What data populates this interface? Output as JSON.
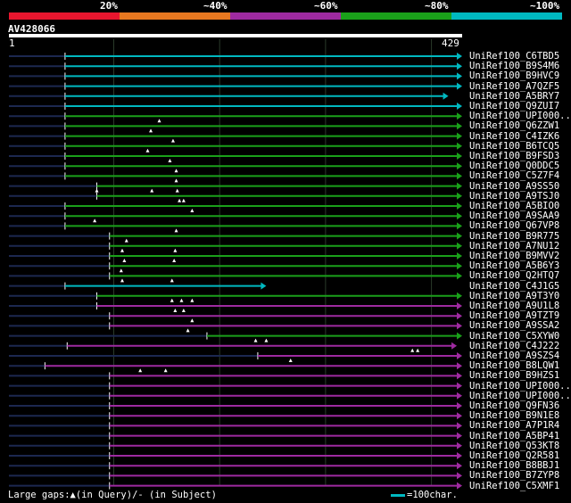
{
  "legend": {
    "labels": [
      "20%",
      "~40%",
      "~60%",
      "~80%",
      "~100%"
    ],
    "colors": [
      "#e8162e",
      "#e87820",
      "#9e2aa0",
      "#1aa01a",
      "#00b8c0"
    ]
  },
  "query": {
    "title": "AV428066",
    "start": "1",
    "end": "429",
    "length": 429
  },
  "footer": {
    "gaps": "Large gaps:▲(in Query)/- (in Subject)",
    "key": "=100char."
  },
  "hits": [
    {
      "name": "UniRef100_C6TBD5",
      "color": "cyan",
      "start": 54,
      "end": 429,
      "arrow": true,
      "ticks": []
    },
    {
      "name": "UniRef100_B9S4M6",
      "color": "cyan",
      "start": 54,
      "end": 429,
      "arrow": true,
      "ticks": []
    },
    {
      "name": "UniRef100_B9HVC9",
      "color": "cyan",
      "start": 54,
      "end": 429,
      "arrow": true,
      "ticks": []
    },
    {
      "name": "UniRef100_A7QZF5",
      "color": "cyan",
      "start": 54,
      "end": 429,
      "arrow": true,
      "ticks": []
    },
    {
      "name": "UniRef100_A5BRY7",
      "color": "cyan",
      "start": 54,
      "end": 416,
      "arrow": true,
      "ticks": []
    },
    {
      "name": "UniRef100_Q9ZUI7",
      "color": "cyan",
      "start": 54,
      "end": 429,
      "arrow": true,
      "ticks": []
    },
    {
      "name": "UniRef100_UPI000...",
      "color": "green",
      "start": 54,
      "end": 429,
      "arrow": true,
      "ticks": [
        143
      ]
    },
    {
      "name": "UniRef100_Q6ZZW1",
      "color": "green",
      "start": 54,
      "end": 429,
      "arrow": true,
      "ticks": [
        135
      ]
    },
    {
      "name": "UniRef100_C4IZK6",
      "color": "green",
      "start": 54,
      "end": 429,
      "arrow": true,
      "ticks": [
        156
      ]
    },
    {
      "name": "UniRef100_B6TCQ5",
      "color": "green",
      "start": 54,
      "end": 429,
      "arrow": true,
      "ticks": [
        132
      ]
    },
    {
      "name": "UniRef100_B9FSD3",
      "color": "green",
      "start": 54,
      "end": 429,
      "arrow": true,
      "ticks": [
        153
      ]
    },
    {
      "name": "UniRef100_Q0DDC5",
      "color": "green",
      "start": 54,
      "end": 429,
      "arrow": true,
      "ticks": [
        159
      ]
    },
    {
      "name": "UniRef100_C5Z7F4",
      "color": "green",
      "start": 54,
      "end": 429,
      "arrow": true,
      "ticks": [
        159
      ]
    },
    {
      "name": "UniRef100_A9SS50",
      "color": "green",
      "start": 84,
      "end": 429,
      "arrow": true,
      "ticks": [
        84,
        136,
        160
      ]
    },
    {
      "name": "UniRef100_A9TSJ0",
      "color": "green",
      "start": 84,
      "end": 429,
      "arrow": true,
      "ticks": [
        162,
        166
      ]
    },
    {
      "name": "UniRef100_A5BIO0",
      "color": "green",
      "start": 54,
      "end": 429,
      "arrow": true,
      "ticks": [
        174
      ]
    },
    {
      "name": "UniRef100_A9SAA9",
      "color": "green",
      "start": 54,
      "end": 429,
      "arrow": true,
      "ticks": [
        82
      ]
    },
    {
      "name": "UniRef100_Q67VP8",
      "color": "green",
      "start": 54,
      "end": 429,
      "arrow": true,
      "ticks": [
        159
      ]
    },
    {
      "name": "UniRef100_B9R775",
      "color": "green",
      "start": 96,
      "end": 429,
      "arrow": true,
      "ticks": [
        112
      ]
    },
    {
      "name": "UniRef100_A7NU12",
      "color": "green",
      "start": 96,
      "end": 429,
      "arrow": true,
      "ticks": [
        108,
        158
      ]
    },
    {
      "name": "UniRef100_B9MVV2",
      "color": "green",
      "start": 96,
      "end": 429,
      "arrow": true,
      "ticks": [
        110,
        157
      ]
    },
    {
      "name": "UniRef100_A5B6Y3",
      "color": "green",
      "start": 96,
      "end": 429,
      "arrow": true,
      "ticks": [
        107
      ]
    },
    {
      "name": "UniRef100_Q2HTQ7",
      "color": "green",
      "start": 96,
      "end": 429,
      "arrow": true,
      "ticks": [
        108,
        155
      ]
    },
    {
      "name": "UniRef100_C4J1G5",
      "color": "cyan",
      "start": 54,
      "end": 244,
      "arrow": true,
      "ticks": []
    },
    {
      "name": "UniRef100_A9T3Y0",
      "color": "green",
      "start": 84,
      "end": 429,
      "arrow": true,
      "ticks": [
        155,
        164,
        174
      ]
    },
    {
      "name": "UniRef100_A9U1L8",
      "color": "purple",
      "start": 84,
      "end": 429,
      "arrow": true,
      "ticks": [
        158,
        166
      ]
    },
    {
      "name": "UniRef100_A9TZT9",
      "color": "purple",
      "start": 96,
      "end": 429,
      "arrow": true,
      "ticks": [
        174
      ]
    },
    {
      "name": "UniRef100_A9SSA2",
      "color": "purple",
      "start": 96,
      "end": 429,
      "arrow": true,
      "ticks": [
        170
      ]
    },
    {
      "name": "UniRef100_C5XYW0",
      "color": "green",
      "start": 188,
      "end": 429,
      "arrow": true,
      "ticks": [
        234,
        244
      ]
    },
    {
      "name": "UniRef100_C4J222",
      "color": "purple",
      "start": 56,
      "end": 424,
      "arrow": true,
      "ticks": [
        382,
        387
      ]
    },
    {
      "name": "UniRef100_A9SZS4",
      "color": "purple",
      "start": 236,
      "end": 429,
      "arrow": true,
      "ticks": [
        267
      ]
    },
    {
      "name": "UniRef100_B8LQW1",
      "color": "purple",
      "start": 35,
      "end": 429,
      "arrow": true,
      "ticks": [
        125,
        149
      ]
    },
    {
      "name": "UniRef100_B9HZS1",
      "color": "purple",
      "start": 96,
      "end": 429,
      "arrow": true,
      "ticks": []
    },
    {
      "name": "UniRef100_UPI000...",
      "color": "purple",
      "start": 96,
      "end": 429,
      "arrow": true,
      "ticks": []
    },
    {
      "name": "UniRef100_UPI000...",
      "color": "purple",
      "start": 96,
      "end": 429,
      "arrow": true,
      "ticks": []
    },
    {
      "name": "UniRef100_Q9FN36",
      "color": "purple",
      "start": 96,
      "end": 429,
      "arrow": true,
      "ticks": []
    },
    {
      "name": "UniRef100_B9N1E8",
      "color": "purple",
      "start": 96,
      "end": 429,
      "arrow": true,
      "ticks": []
    },
    {
      "name": "UniRef100_A7P1R4",
      "color": "purple",
      "start": 96,
      "end": 429,
      "arrow": true,
      "ticks": []
    },
    {
      "name": "UniRef100_A5BP41",
      "color": "purple",
      "start": 96,
      "end": 429,
      "arrow": true,
      "ticks": []
    },
    {
      "name": "UniRef100_Q53KT8",
      "color": "purple",
      "start": 96,
      "end": 429,
      "arrow": true,
      "ticks": []
    },
    {
      "name": "UniRef100_Q2R581",
      "color": "purple",
      "start": 96,
      "end": 429,
      "arrow": true,
      "ticks": []
    },
    {
      "name": "UniRef100_B8BBJ1",
      "color": "purple",
      "start": 96,
      "end": 429,
      "arrow": true,
      "ticks": []
    },
    {
      "name": "UniRef100_B7ZYP8",
      "color": "purple",
      "start": 96,
      "end": 429,
      "arrow": true,
      "ticks": []
    },
    {
      "name": "UniRef100_C5XMF1",
      "color": "purple",
      "start": 96,
      "end": 429,
      "arrow": true,
      "ticks": []
    }
  ]
}
